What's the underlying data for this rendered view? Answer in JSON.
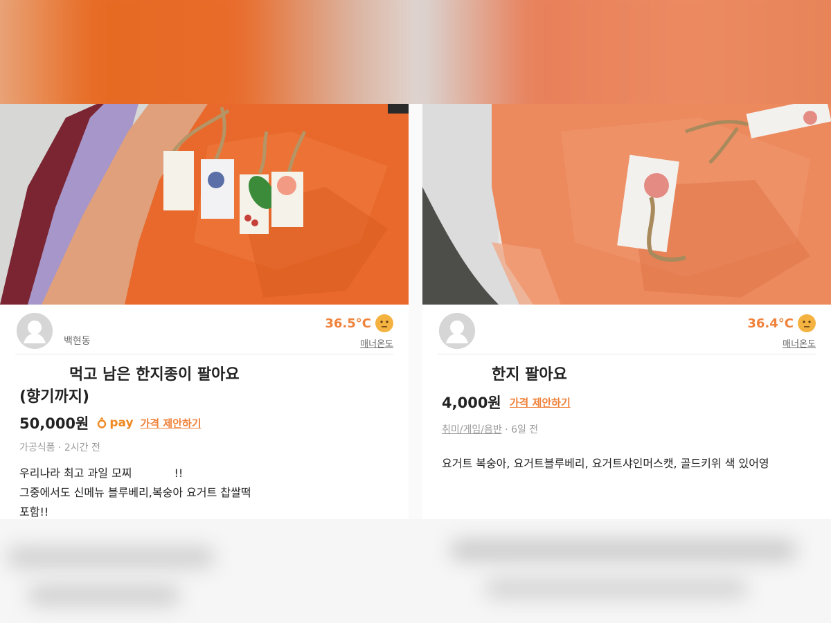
{
  "left": {
    "seller_name": "백현동",
    "temperature": "36.5°C",
    "manner_label": "매너온도",
    "title_line1": "먹고 남은 한지종이 팔아요",
    "title_line2": "(향기까지)",
    "price": "50,000원",
    "pay_label": "pay",
    "offer_label": "가격 제안하기",
    "meta": "가공식품 · 2시간 전",
    "desc_line1": "우리나라 최고 과일 모찌            !!",
    "desc_line2": "그중에서도 신메뉴 블루베리,복숭아 요거트 찹쌀떡",
    "desc_line3": "포함!!"
  },
  "right": {
    "temperature": "36.4°C",
    "manner_label": "매너온도",
    "title": "한지 팔아요",
    "price": "4,000원",
    "offer_label": "가격 제안하기",
    "category": "취미/게임/음반",
    "meta_time": " · 6일 전",
    "desc_line1": "요거트 복숭아, 요거트블루베리, 요거트샤인머스캣, 골드키위 색 있어영"
  },
  "colors": {
    "accent_orange": "#f0813a",
    "pay_orange": "#f08a24",
    "temp_face": "#f4b340"
  },
  "icons": [
    "avatar-placeholder-icon",
    "temperature-face-icon",
    "carrot-pay-icon"
  ]
}
